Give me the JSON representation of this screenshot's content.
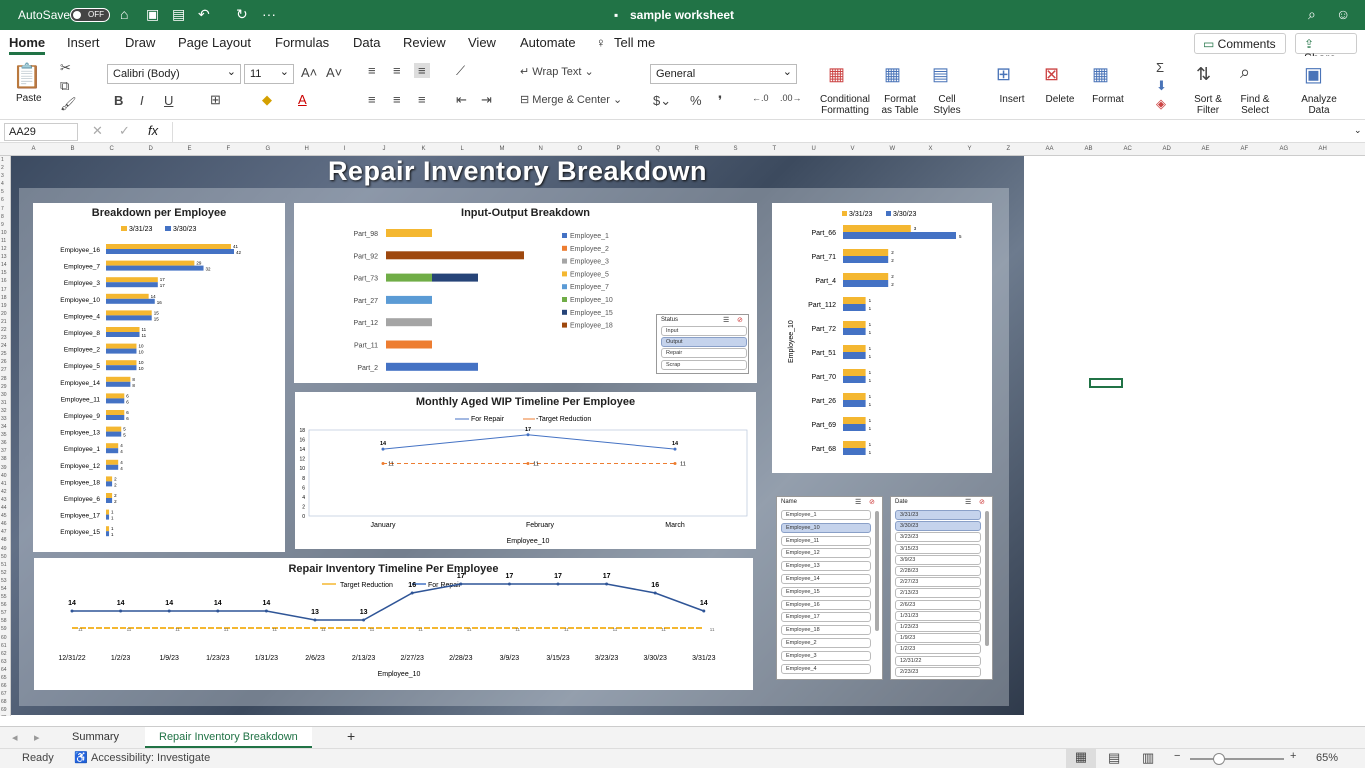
{
  "titlebar": {
    "autosave": "AutoSave",
    "toggle": "OFF",
    "filename": "sample worksheet"
  },
  "tabs": [
    "Home",
    "Insert",
    "Draw",
    "Page Layout",
    "Formulas",
    "Data",
    "Review",
    "View",
    "Automate",
    "Tell me"
  ],
  "top_buttons": {
    "comments": "Comments",
    "share": "Share"
  },
  "ribbon": {
    "paste": "Paste",
    "font": "Calibri (Body)",
    "size": "11",
    "wrap": "Wrap Text",
    "merge": "Merge & Center",
    "numfmt": "General",
    "cond": "Conditional\nFormatting",
    "fmt_table": "Format\nas Table",
    "cell_styles": "Cell\nStyles",
    "insert": "Insert",
    "delete": "Delete",
    "format": "Format",
    "sort": "Sort &\nFilter",
    "find": "Find &\nSelect",
    "analyze": "Analyze\nData"
  },
  "formula": {
    "cell_ref": "AA29",
    "fx": "fx"
  },
  "columns": [
    "A",
    "B",
    "C",
    "D",
    "E",
    "F",
    "G",
    "H",
    "I",
    "J",
    "K",
    "L",
    "M",
    "N",
    "O",
    "P",
    "Q",
    "R",
    "S",
    "T",
    "U",
    "V",
    "W",
    "X",
    "Y",
    "Z",
    "AA",
    "AB",
    "AC",
    "AD",
    "AE",
    "AF",
    "AG",
    "AH"
  ],
  "dashboard": {
    "title": "Repair Inventory Breakdown"
  },
  "chart_data": [
    {
      "type": "bar",
      "title": "Breakdown per Employee",
      "categories": [
        "Employee_16",
        "Employee_7",
        "Employee_3",
        "Employee_10",
        "Employee_4",
        "Employee_8",
        "Employee_2",
        "Employee_5",
        "Employee_14",
        "Employee_11",
        "Employee_9",
        "Employee_13",
        "Employee_1",
        "Employee_12",
        "Employee_18",
        "Employee_6",
        "Employee_17",
        "Employee_15"
      ],
      "series": [
        {
          "name": "3/31/23",
          "values": [
            41,
            29,
            17,
            14,
            15,
            11,
            10,
            10,
            8,
            6,
            6,
            5,
            4,
            4,
            2,
            2,
            1,
            1
          ]
        },
        {
          "name": "3/30/23",
          "values": [
            42,
            32,
            17,
            16,
            15,
            11,
            10,
            10,
            8,
            6,
            6,
            5,
            4,
            4,
            2,
            2,
            1,
            1
          ]
        }
      ],
      "colors": [
        "#f4b731",
        "#4472c4"
      ]
    },
    {
      "type": "bar",
      "title": "Input-Output Breakdown",
      "categories": [
        "Part_98",
        "Part_92",
        "Part_73",
        "Part_27",
        "Part_12",
        "Part_11",
        "Part_2"
      ],
      "legend": [
        "Employee_1",
        "Employee_2",
        "Employee_3",
        "Employee_5",
        "Employee_7",
        "Employee_10",
        "Employee_15",
        "Employee_18"
      ],
      "legend_colors": [
        "#4472c4",
        "#ed7d31",
        "#a5a5a5",
        "#f4b731",
        "#5b9bd5",
        "#70ad47",
        "#264478",
        "#9e480e"
      ],
      "bars": [
        {
          "part": "Part_98",
          "segments": [
            {
              "series": "Employee_5",
              "value": 1
            }
          ]
        },
        {
          "part": "Part_92",
          "segments": [
            {
              "series": "Employee_18",
              "value": 3
            }
          ]
        },
        {
          "part": "Part_73",
          "segments": [
            {
              "series": "Employee_10",
              "value": 1
            },
            {
              "series": "Employee_15",
              "value": 1
            }
          ]
        },
        {
          "part": "Part_27",
          "segments": [
            {
              "series": "Employee_7",
              "value": 1
            }
          ]
        },
        {
          "part": "Part_12",
          "segments": [
            {
              "series": "Employee_3",
              "value": 1
            }
          ]
        },
        {
          "part": "Part_11",
          "segments": [
            {
              "series": "Employee_2",
              "value": 1
            }
          ]
        },
        {
          "part": "Part_2",
          "segments": [
            {
              "series": "Employee_1",
              "value": 2
            }
          ]
        }
      ]
    },
    {
      "type": "bar",
      "title": "",
      "ylabel": "Employee_10",
      "categories": [
        "Part_66",
        "Part_71",
        "Part_4",
        "Part_112",
        "Part_72",
        "Part_51",
        "Part_70",
        "Part_26",
        "Part_69",
        "Part_68"
      ],
      "series": [
        {
          "name": "3/31/23",
          "values": [
            3,
            2,
            2,
            1,
            1,
            1,
            1,
            1,
            1,
            1
          ]
        },
        {
          "name": "3/30/23",
          "values": [
            5,
            2,
            2,
            1,
            1,
            1,
            1,
            1,
            1,
            1
          ]
        }
      ]
    },
    {
      "type": "line",
      "title": "Monthly  Aged WIP Timeline Per Employee",
      "xlabel": "Employee_10",
      "categories": [
        "January",
        "February",
        "March"
      ],
      "ylim": [
        0,
        18
      ],
      "yticks": [
        0,
        2,
        4,
        6,
        8,
        10,
        12,
        14,
        16,
        18
      ],
      "series": [
        {
          "name": "For Repair",
          "values": [
            14,
            17,
            14
          ]
        },
        {
          "name": "Target Reduction",
          "values": [
            11,
            11,
            11
          ]
        }
      ]
    },
    {
      "type": "line",
      "title": "Repair Inventory Timeline Per Employee",
      "xlabel": "Employee_10",
      "categories": [
        "12/31/22",
        "1/2/23",
        "1/9/23",
        "1/23/23",
        "1/31/23",
        "2/6/23",
        "2/13/23",
        "2/27/23",
        "2/28/23",
        "3/9/23",
        "3/15/23",
        "3/23/23",
        "3/30/23",
        "3/31/23"
      ],
      "series": [
        {
          "name": "Target Reduction",
          "values": [
            11,
            11,
            11,
            11,
            11,
            11,
            11,
            11,
            11,
            11,
            11,
            11,
            11,
            11
          ]
        },
        {
          "name": "For Repair",
          "values": [
            14,
            14,
            14,
            14,
            14,
            13,
            13,
            16,
            17,
            17,
            17,
            17,
            16,
            14
          ]
        }
      ]
    }
  ],
  "slicers": {
    "status": {
      "title": "Status",
      "items": [
        "Input",
        "Output",
        "Repair",
        "Scrap"
      ],
      "selected": [
        1
      ]
    },
    "name": {
      "title": "Name",
      "items": [
        "Employee_1",
        "Employee_10",
        "Employee_11",
        "Employee_12",
        "Employee_13",
        "Employee_14",
        "Employee_15",
        "Employee_16",
        "Employee_17",
        "Employee_18",
        "Employee_2",
        "Employee_3",
        "Employee_4"
      ],
      "selected": [
        1
      ]
    },
    "date": {
      "title": "Date",
      "items": [
        "3/31/23",
        "3/30/23",
        "3/23/23",
        "3/15/23",
        "3/9/23",
        "2/28/23",
        "2/27/23",
        "2/13/23",
        "2/6/23",
        "1/31/23",
        "1/23/23",
        "1/9/23",
        "1/2/23",
        "12/31/22",
        "2/23/23"
      ],
      "selected": [
        0,
        1
      ]
    }
  },
  "sheets": [
    "Summary",
    "Repair Inventory Breakdown"
  ],
  "status": {
    "ready": "Ready",
    "accessibility": "Accessibility: Investigate",
    "zoom": "65%"
  }
}
